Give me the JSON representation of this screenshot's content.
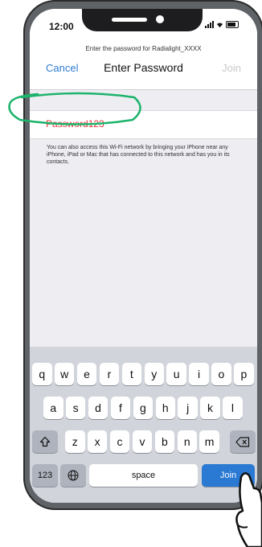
{
  "status_bar": {
    "time": "12:00"
  },
  "header": {
    "prompt": "Enter the password for Radialight_XXXX",
    "cancel_label": "Cancel",
    "title": "Enter Password",
    "join_label": "Join"
  },
  "password_field": {
    "value": "Password123"
  },
  "info_text": "You can also access this Wi-Fi network by bringing your iPhone near any iPhone, iPad or Mac that has connected to this network and has you in its contacts.",
  "keyboard": {
    "row1": [
      "q",
      "w",
      "e",
      "r",
      "t",
      "y",
      "u",
      "i",
      "o",
      "p"
    ],
    "row2": [
      "a",
      "s",
      "d",
      "f",
      "g",
      "h",
      "j",
      "k",
      "l"
    ],
    "row3": [
      "z",
      "x",
      "c",
      "v",
      "b",
      "n",
      "m"
    ],
    "numbers_label": "123",
    "space_label": "space",
    "join_label": "Join"
  },
  "colors": {
    "accent": "#2f7bd1",
    "join_key": "#2a79d3",
    "password_text": "#e8343a",
    "highlight_ring": "#1db36b",
    "phone_body": "#5f6266"
  }
}
